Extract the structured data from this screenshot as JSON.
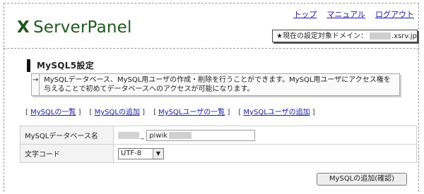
{
  "header": {
    "nav": [
      "トップ",
      "マニュアル",
      "ログアウト"
    ],
    "logo": "ServerPanel",
    "logo_mark": "X",
    "domain_label": "★現在の設定対象ドメイン：",
    "domain_suffix": ".xsrv.jp"
  },
  "section": {
    "title": "MySQL5設定",
    "notice_arrow": "→",
    "notice_text": "MySQLデータベース、MySQL用ユーザの作成・削除を行うことができます。MySQL用ユーザにアクセス権を与えることで初めてデータベースへのアクセスが可能になります。"
  },
  "links": [
    "MySQLの一覧",
    "MySQLの追加",
    "MySQLユーザの一覧",
    "MySQLユーザの追加"
  ],
  "form": {
    "db_label": "MySQLデータベース名",
    "db_separator": "_",
    "db_value": "piwik",
    "charset_label": "文字コード",
    "charset_value": "UTF-8",
    "submit_label": "MySQLの追加(確認)"
  }
}
